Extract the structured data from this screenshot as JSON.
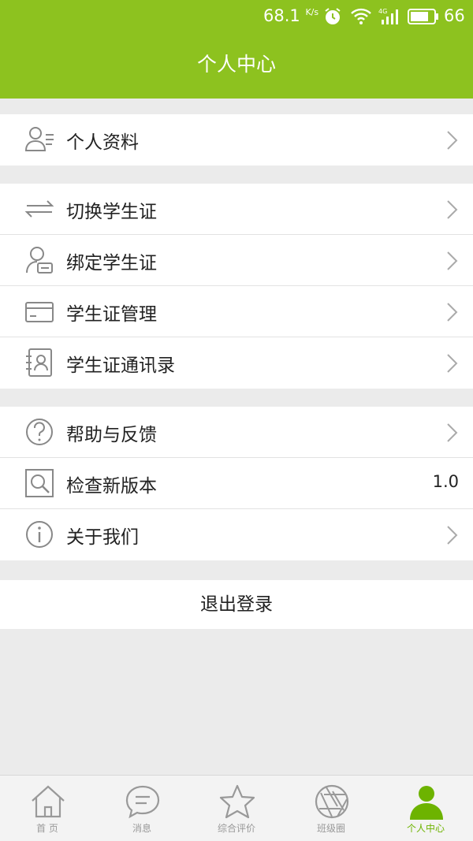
{
  "status_bar": {
    "speed": "68.1",
    "speed_unit": "K/s",
    "battery": "66"
  },
  "header": {
    "title": "个人中心"
  },
  "groups": [
    {
      "items": [
        {
          "label": "个人资料",
          "icon": "profile-icon"
        }
      ]
    },
    {
      "items": [
        {
          "label": "切换学生证",
          "icon": "switch-icon"
        },
        {
          "label": "绑定学生证",
          "icon": "bind-user-icon"
        },
        {
          "label": "学生证管理",
          "icon": "card-icon"
        },
        {
          "label": "学生证通讯录",
          "icon": "contacts-icon"
        }
      ]
    },
    {
      "items": [
        {
          "label": "帮助与反馈",
          "icon": "help-icon"
        },
        {
          "label": "检查新版本",
          "icon": "search-icon",
          "value": "1.0"
        },
        {
          "label": "关于我们",
          "icon": "info-icon"
        }
      ]
    }
  ],
  "logout_label": "退出登录",
  "tabs": [
    {
      "label": "首 页",
      "icon": "home-icon"
    },
    {
      "label": "消息",
      "icon": "message-icon"
    },
    {
      "label": "综合评价",
      "icon": "star-icon"
    },
    {
      "label": "班级圈",
      "icon": "aperture-icon"
    },
    {
      "label": "个人中心",
      "icon": "person-icon",
      "active": true
    }
  ],
  "colors": {
    "accent": "#8dc21f",
    "tab_active": "#6db300",
    "background": "#ebebeb"
  }
}
